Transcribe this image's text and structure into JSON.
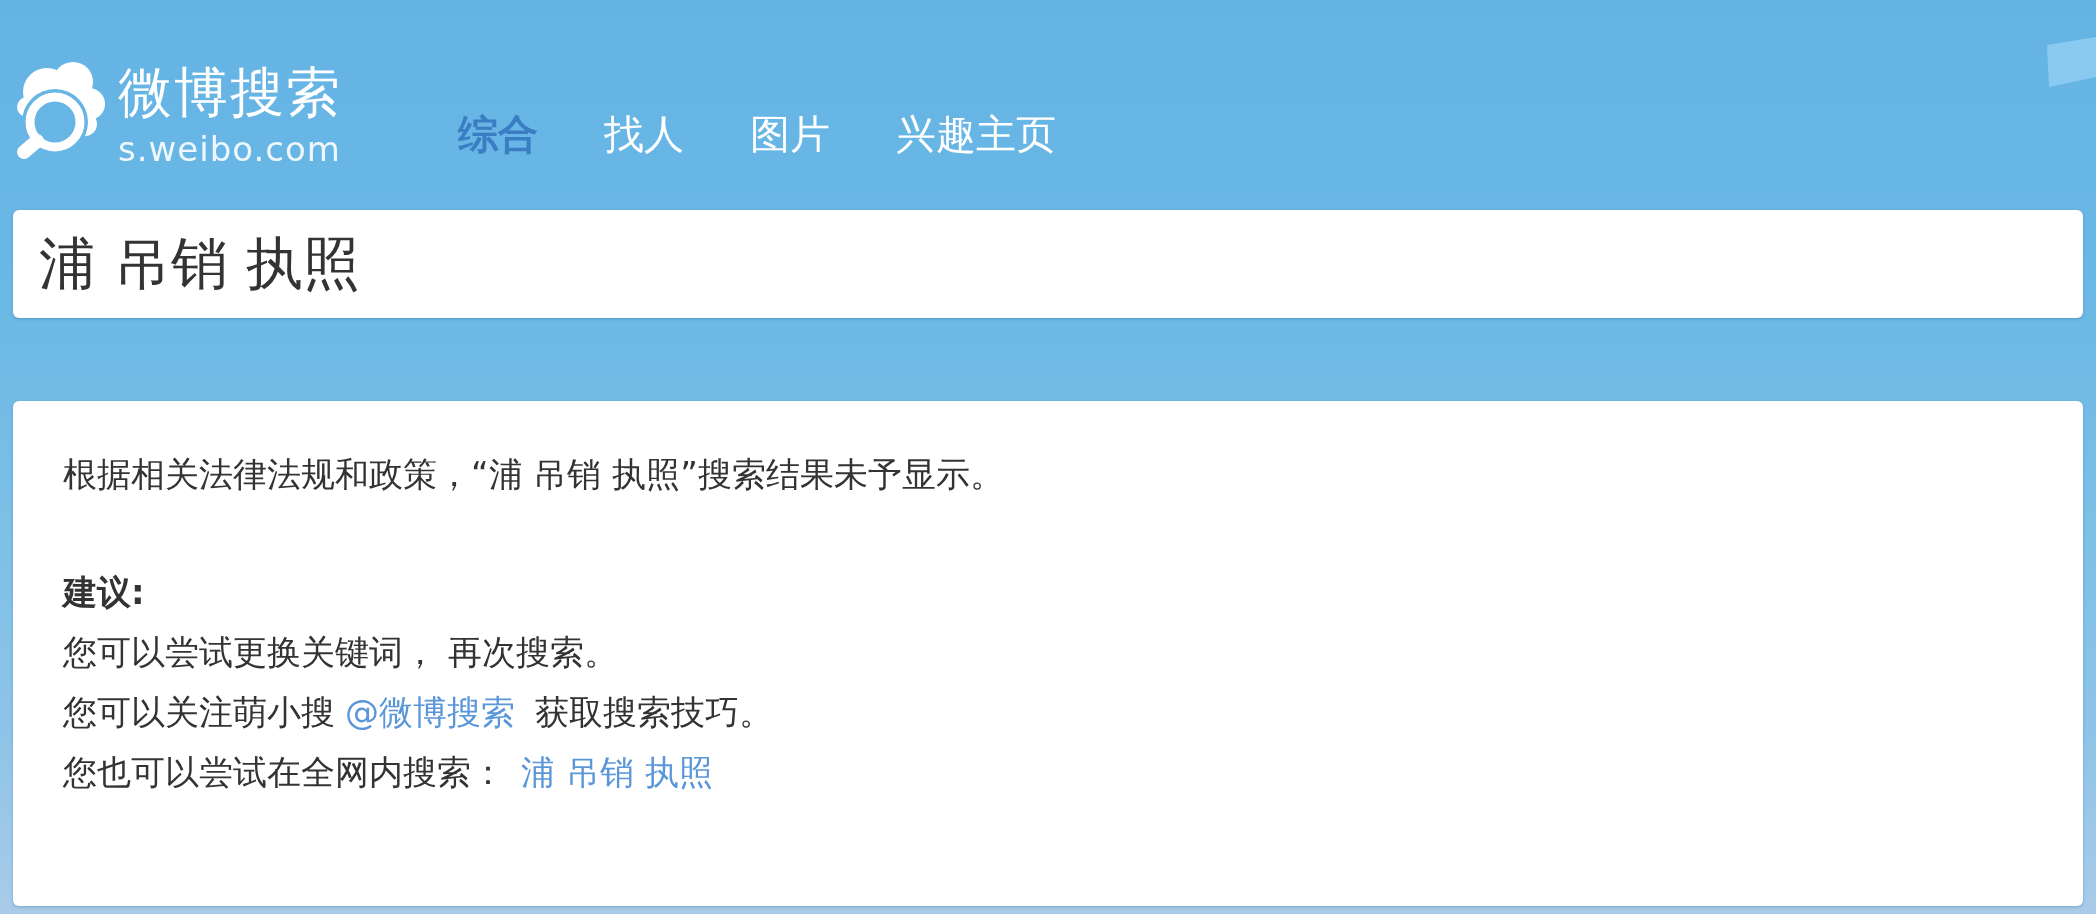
{
  "header": {
    "logo": {
      "title": "微博搜索",
      "domain": "s.weibo.com"
    },
    "tabs": [
      {
        "label": "综合",
        "selected": true
      },
      {
        "label": "找人",
        "selected": false
      },
      {
        "label": "图片",
        "selected": false
      },
      {
        "label": "兴趣主页",
        "selected": false
      }
    ]
  },
  "search": {
    "value": "浦 吊销 执照"
  },
  "result": {
    "notice": "根据相关法律法规和政策，“浦 吊销 执照”搜索结果未予显示。",
    "heading": "建议:",
    "suggestions": [
      {
        "kind": "text",
        "text": "您可以尝试更换关键词， 再次搜索。"
      },
      {
        "kind": "link",
        "before": "您可以关注萌小搜",
        "link": "@微博搜索",
        "after": "获取搜索技巧。"
      },
      {
        "kind": "link",
        "before": "您也可以尝试在全网内搜索：",
        "link": "浦 吊销 执照"
      }
    ]
  }
}
